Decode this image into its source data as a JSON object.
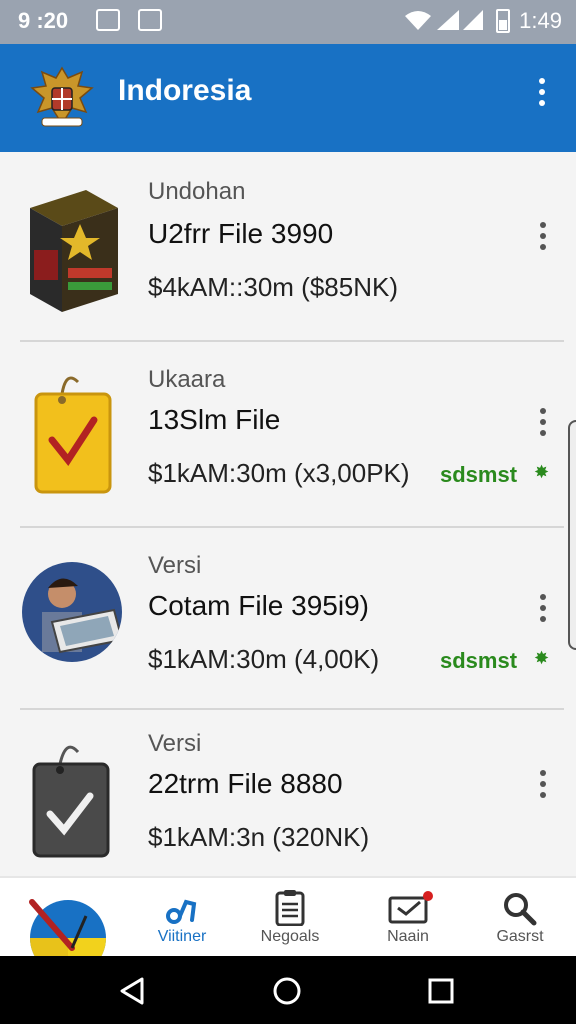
{
  "status_bar": {
    "time_left": "9 :20",
    "time_right": "1:49"
  },
  "app_bar": {
    "title": "Indoresia"
  },
  "items": [
    {
      "category": "Undohan",
      "filename": "U2frr File 3990",
      "meta": "$4kAM::30m ($85NK)",
      "tag": ""
    },
    {
      "category": "Ukaara",
      "filename": "13Slm File",
      "meta": "$1kAM:30m (x3,00PK)",
      "tag": "sdsmst"
    },
    {
      "category": "Versi",
      "filename": "Cotam File 395i9)",
      "meta": "$1kAM:30m (4,00K)",
      "tag": "sdsmst"
    },
    {
      "category": "Versi",
      "filename": "22trm File 8880",
      "meta": "$1kAM:3n (320NK)",
      "tag": ""
    }
  ],
  "bottom_nav": [
    {
      "label": "Viitiner",
      "icon": "music-note-icon",
      "active": true
    },
    {
      "label": "Negoals",
      "icon": "clipboard-icon",
      "active": false
    },
    {
      "label": "Naain",
      "icon": "inbox-icon",
      "active": false
    },
    {
      "label": "Gasrst",
      "icon": "search-icon",
      "active": false
    }
  ],
  "colors": {
    "app_bar": "#1871c4",
    "tag": "#2a8a1d",
    "status_bar": "#9aa3b0"
  }
}
